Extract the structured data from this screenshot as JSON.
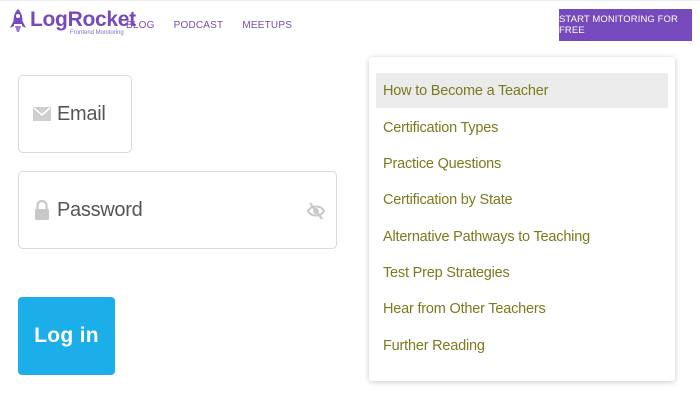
{
  "header": {
    "logo": {
      "name": "LogRocket",
      "tagline": "Frontend Monitoring"
    },
    "nav": [
      {
        "label": "BLOG"
      },
      {
        "label": "PODCAST"
      },
      {
        "label": "MEETUPS"
      }
    ],
    "cta_label": "START MONITORING FOR FREE"
  },
  "form": {
    "email_label": "Email",
    "password_label": "Password",
    "login_label": "Log in"
  },
  "menu": {
    "items": [
      {
        "label": "How to Become a Teacher",
        "active": true
      },
      {
        "label": "Certification Types",
        "active": false
      },
      {
        "label": "Practice Questions",
        "active": false
      },
      {
        "label": "Certification by State",
        "active": false
      },
      {
        "label": "Alternative Pathways to Teaching",
        "active": false
      },
      {
        "label": "Test Prep Strategies",
        "active": false
      },
      {
        "label": "Hear from Other Teachers",
        "active": false
      },
      {
        "label": "Further Reading",
        "active": false
      }
    ]
  },
  "colors": {
    "brand": "#764abc",
    "login_button": "#1baee8",
    "menu_text": "#7b7a1e",
    "menu_highlight": "#ebebeb"
  },
  "icons": {
    "logo": "rocket-icon",
    "email": "envelope-icon",
    "password": "lock-icon",
    "visibility": "eye-off-icon"
  }
}
